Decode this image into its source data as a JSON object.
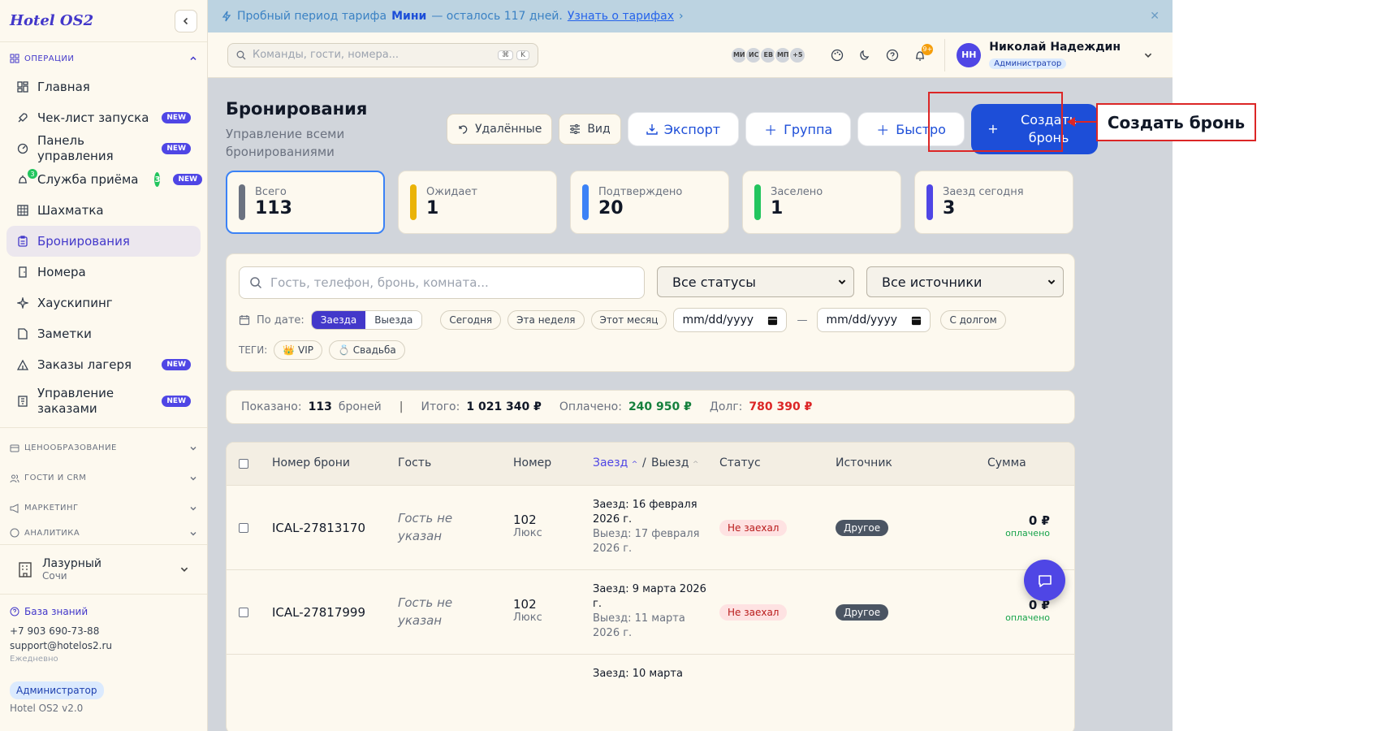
{
  "app": {
    "logo": "Hotel OS2"
  },
  "sidebar": {
    "section_ops": "ОПЕРАЦИИ",
    "items": [
      {
        "label": "Главная",
        "icon": "dashboard-icon"
      },
      {
        "label": "Чек-лист запуска",
        "badge": "NEW",
        "icon": "rocket-icon"
      },
      {
        "label": "Панель управления",
        "badge": "NEW",
        "icon": "gauge-icon"
      },
      {
        "label": "Служба приёма",
        "count": "3",
        "badge": "NEW",
        "icon": "bell-icon"
      },
      {
        "label": "Шахматка",
        "icon": "grid-icon"
      },
      {
        "label": "Бронирования",
        "icon": "clipboard-icon"
      },
      {
        "label": "Номера",
        "icon": "door-icon"
      },
      {
        "label": "Хаускипинг",
        "icon": "sparkle-icon"
      },
      {
        "label": "Заметки",
        "icon": "note-icon"
      },
      {
        "label": "Заказы лагеря",
        "badge": "NEW",
        "icon": "tent-icon"
      },
      {
        "label": "Управление заказами",
        "badge": "NEW",
        "icon": "receipt-icon"
      }
    ],
    "sections": [
      "ЦЕНООБРАЗОВАНИЕ",
      "ГОСТИ И CRM",
      "МАРКЕТИНГ",
      "АНАЛИТИКА"
    ],
    "hotel": {
      "name": "Лазурный",
      "city": "Сочи"
    },
    "footer": {
      "kb": "База знаний",
      "phone": "+7 903 690-73-88",
      "email": "support@hotelos2.ru",
      "daily": "Ежедневно",
      "role": "Администратор",
      "version": "Hotel OS2 v2.0"
    }
  },
  "trial": {
    "prefix": "Пробный период тарифа",
    "plan": "Мини",
    "suffix": "— осталось 117 дней.",
    "link": "Узнать о тарифах"
  },
  "topbar": {
    "search_placeholder": "Команды, гости, номера...",
    "kbd1": "⌘",
    "kbd2": "K",
    "avatars": [
      "МИ",
      "ИС",
      "ЕВ",
      "МП",
      "+5"
    ],
    "notif_count": "9+",
    "user": {
      "initials": "НН",
      "name": "Николай Надеждин",
      "role": "Администратор"
    }
  },
  "page": {
    "title": "Бронирования",
    "subtitle": "Управление всеми бронированиями",
    "btn_deleted": "Удалённые",
    "btn_view": "Вид",
    "btn_export": "Экспорт",
    "btn_group": "Группа",
    "btn_quick": "Быстро",
    "btn_create": "Создать бронь"
  },
  "stats": [
    {
      "label": "Всего",
      "value": "113",
      "color": "#6b7280"
    },
    {
      "label": "Ожидает",
      "value": "1",
      "color": "#eab308"
    },
    {
      "label": "Подтверждено",
      "value": "20",
      "color": "#3b82f6"
    },
    {
      "label": "Заселено",
      "value": "1",
      "color": "#22c55e"
    },
    {
      "label": "Заезд сегодня",
      "value": "3",
      "color": "#4f46e5"
    }
  ],
  "filters": {
    "search_placeholder": "Гость, телефон, бронь, комната...",
    "status": "Все статусы",
    "source": "Все источники",
    "by_date": "По дате:",
    "seg_in": "Заезда",
    "seg_out": "Выезда",
    "today": "Сегодня",
    "week": "Эта неделя",
    "month": "Этот месяц",
    "date_ph": "mm/dd/yyyy",
    "dash": "—",
    "debt": "С долгом",
    "tags_label": "ТЕГИ:",
    "tag_vip": "VIP",
    "tag_wedding": "Свадьба"
  },
  "summary": {
    "shown_label": "Показано:",
    "shown": "113",
    "shown_unit": "броней",
    "total_label": "Итого:",
    "total": "1 021 340 ₽",
    "paid_label": "Оплачено:",
    "paid": "240 950 ₽",
    "debt_label": "Долг:",
    "debt": "780 390 ₽"
  },
  "table": {
    "headers": {
      "num": "Номер брони",
      "guest": "Гость",
      "room": "Номер",
      "checkin": "Заезд",
      "slash": "/",
      "checkout": "Выезд",
      "status": "Статус",
      "source": "Источник",
      "sum": "Сумма"
    },
    "rows": [
      {
        "id": "ICAL-27813170",
        "guest": "Гость не указан",
        "room": "102",
        "room_type": "Люкс",
        "in": "Заезд: 16 февраля 2026 г.",
        "out": "Выезд: 17 февраля 2026 г.",
        "status": "Не заехал",
        "source": "Другое",
        "amount": "0 ₽",
        "paid": "оплачено"
      },
      {
        "id": "ICAL-27817999",
        "guest": "Гость не указан",
        "room": "102",
        "room_type": "Люкс",
        "in": "Заезд: 9 марта 2026 г.",
        "out": "Выезд: 11 марта 2026 г.",
        "status": "Не заехал",
        "source": "Другое",
        "amount": "0 ₽",
        "paid": "оплачено"
      },
      {
        "in": "Заезд: 10 марта"
      }
    ]
  },
  "callout": {
    "label": "Создать бронь"
  }
}
